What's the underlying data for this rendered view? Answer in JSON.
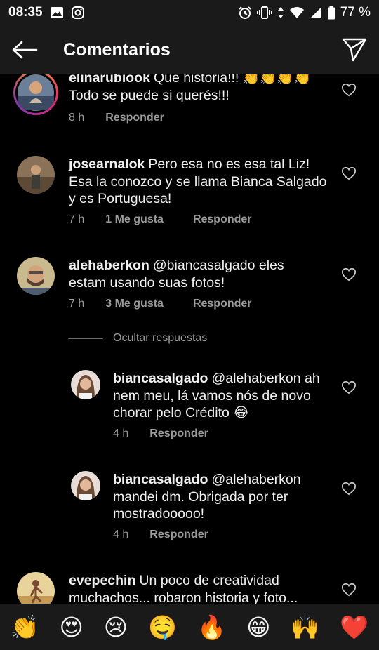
{
  "status_bar": {
    "time": "08:35",
    "battery_text": "77 %"
  },
  "header": {
    "title": "Comentarios"
  },
  "comments": [
    {
      "username": "elinarubiook",
      "text": "Que historia!!! 👏👏👏👏 Todo se puede si querés!!!",
      "time": "8 h",
      "likes": "",
      "reply": "Responder"
    },
    {
      "username": "josearnalok",
      "text": "Pero esa no es esa tal Liz! Esa la conozco y se llama Bianca Salgado y es Portuguesa!",
      "time": "7 h",
      "likes": "1 Me gusta",
      "reply": "Responder"
    },
    {
      "username": "alehaberkon",
      "text": "@biancasalgado eles estam usando suas fotos!",
      "time": "7 h",
      "likes": "3 Me gusta",
      "reply": "Responder"
    },
    {
      "username": "biancasalgado",
      "text": "@alehaberkon ah nem meu, lá vamos nós de novo chorar pelo Crédito 😂",
      "time": "4 h",
      "likes": "",
      "reply": "Responder"
    },
    {
      "username": "biancasalgado",
      "text": "@alehaberkon mandei dm. Obrigada por ter mostradooooo!",
      "time": "4 h",
      "likes": "",
      "reply": "Responder"
    },
    {
      "username": "evepechin",
      "text": "Un poco de creatividad muchachos... robaron historia y foto...",
      "time": "",
      "likes": "",
      "reply": ""
    }
  ],
  "hide_replies_label": "Ocultar respuestas",
  "emoji_bar": [
    "👏",
    "😍",
    "😢",
    "🤤",
    "🔥",
    "😁",
    "🙌",
    "❤️"
  ],
  "colors": {
    "background": "#000000",
    "bar": "#1a1a1a",
    "secondary_text": "#9a9a9a",
    "heart_red": "#e0245e"
  },
  "icons": {
    "back": "arrow-left-icon",
    "send": "paper-plane-icon",
    "like": "heart-outline-icon"
  }
}
